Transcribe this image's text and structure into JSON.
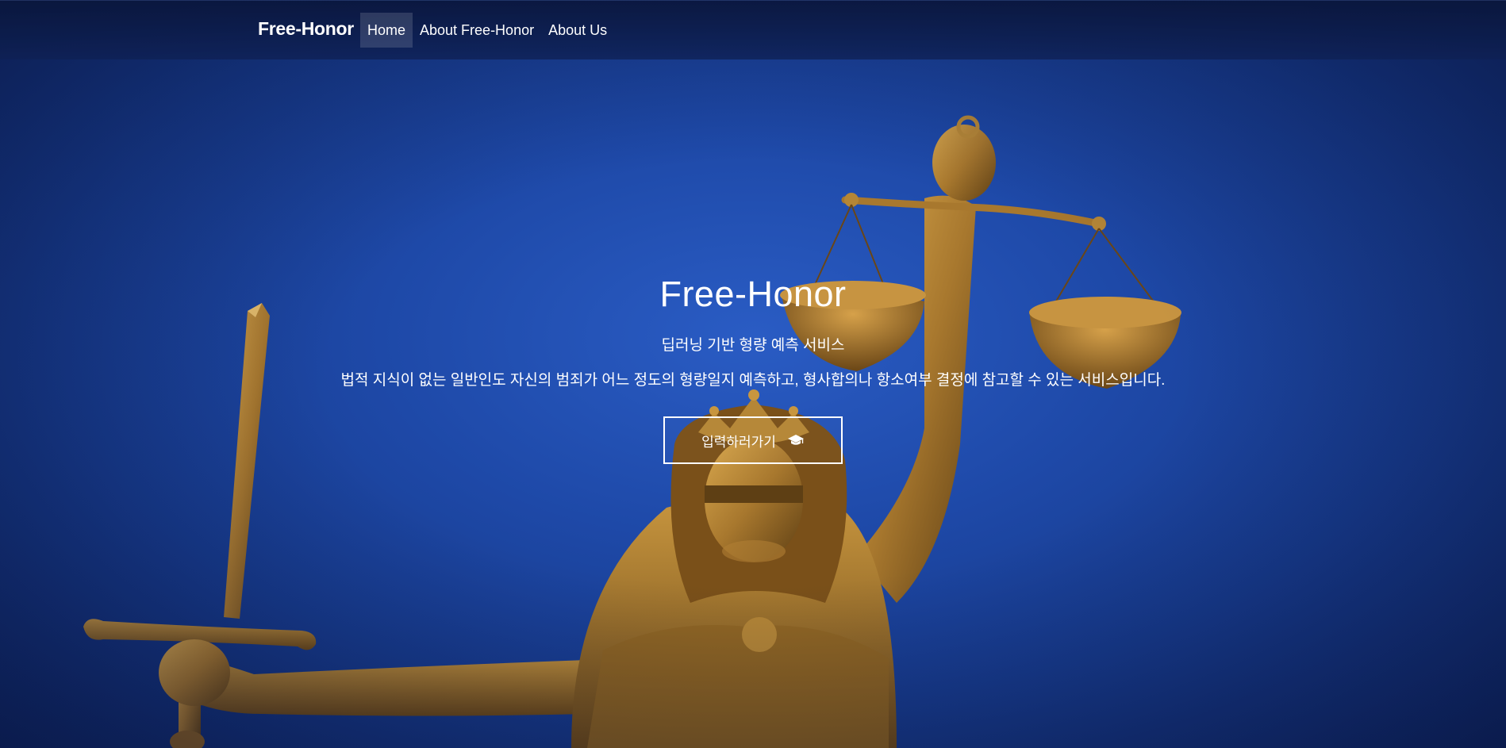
{
  "navbar": {
    "brand": "Free-Honor",
    "items": [
      {
        "label": "Home",
        "active": true
      },
      {
        "label": "About Free-Honor",
        "active": false
      },
      {
        "label": "About Us",
        "active": false
      }
    ]
  },
  "hero": {
    "title": "Free-Honor",
    "subtitle": "딥러닝 기반 형량 예측 서비스",
    "description": "법적 지식이 없는 일반인도 자신의 범죄가 어느 정도의 형량일지 예측하고, 형사합의나 항소여부 결정에 참고할 수 있는 서비스입니다.",
    "cta_label": "입력하러가기",
    "cta_icon": "graduation-cap-icon",
    "background_image": "lady-justice-statue"
  },
  "colors": {
    "sky_center": "#2a5cc4",
    "sky_edge": "#0f2563",
    "bronze": "#a8782e",
    "text": "#ffffff"
  }
}
